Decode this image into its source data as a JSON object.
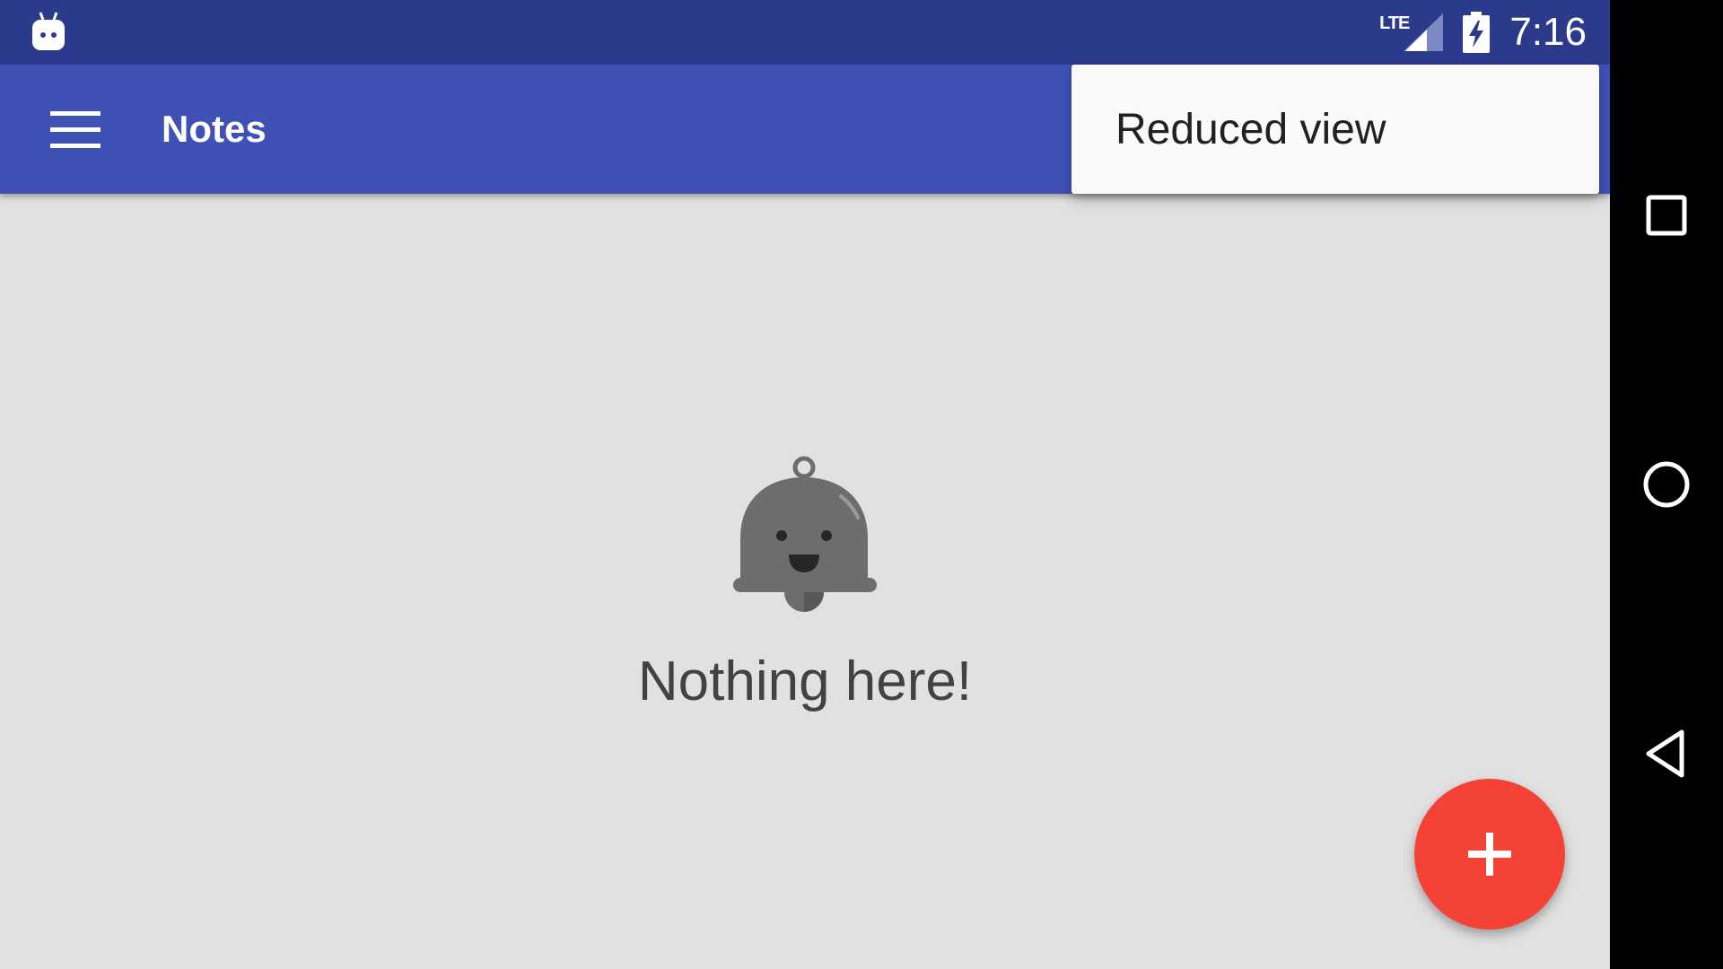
{
  "status_bar": {
    "network_label": "LTE",
    "time": "7:16",
    "icons": [
      "android-app-icon",
      "signal-icon",
      "battery-charging-icon"
    ]
  },
  "app_bar": {
    "title": "Notes",
    "menu_icon": "hamburger-menu-icon"
  },
  "overflow_menu": {
    "items": [
      {
        "label": "Reduced view"
      }
    ]
  },
  "empty_state": {
    "icon": "smiling-bell-icon",
    "message": "Nothing here!"
  },
  "fab": {
    "icon": "plus-icon"
  },
  "nav_bar": {
    "buttons": [
      "recents-icon",
      "home-icon",
      "back-icon"
    ]
  },
  "colors": {
    "status_bar": "#2c3a8c",
    "app_bar": "#3f51b5",
    "background": "#e1e1e1",
    "fab": "#f44336",
    "nav_bar": "#000000"
  }
}
